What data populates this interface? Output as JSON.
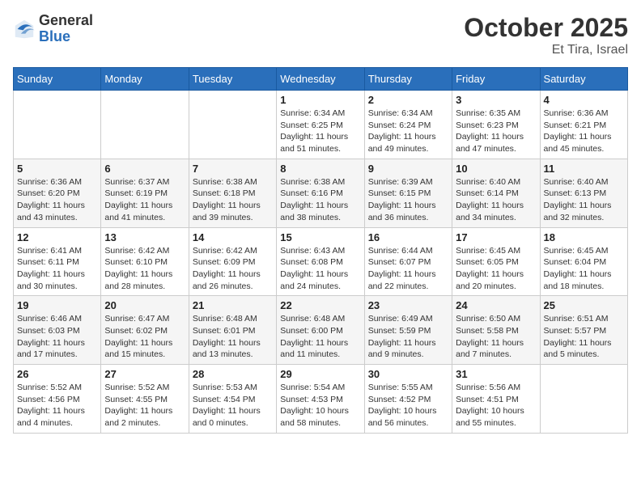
{
  "header": {
    "logo_general": "General",
    "logo_blue": "Blue",
    "month_title": "October 2025",
    "location": "Et Tira, Israel"
  },
  "days_of_week": [
    "Sunday",
    "Monday",
    "Tuesday",
    "Wednesday",
    "Thursday",
    "Friday",
    "Saturday"
  ],
  "weeks": [
    [
      {
        "day": "",
        "info": ""
      },
      {
        "day": "",
        "info": ""
      },
      {
        "day": "",
        "info": ""
      },
      {
        "day": "1",
        "info": "Sunrise: 6:34 AM\nSunset: 6:25 PM\nDaylight: 11 hours\nand 51 minutes."
      },
      {
        "day": "2",
        "info": "Sunrise: 6:34 AM\nSunset: 6:24 PM\nDaylight: 11 hours\nand 49 minutes."
      },
      {
        "day": "3",
        "info": "Sunrise: 6:35 AM\nSunset: 6:23 PM\nDaylight: 11 hours\nand 47 minutes."
      },
      {
        "day": "4",
        "info": "Sunrise: 6:36 AM\nSunset: 6:21 PM\nDaylight: 11 hours\nand 45 minutes."
      }
    ],
    [
      {
        "day": "5",
        "info": "Sunrise: 6:36 AM\nSunset: 6:20 PM\nDaylight: 11 hours\nand 43 minutes."
      },
      {
        "day": "6",
        "info": "Sunrise: 6:37 AM\nSunset: 6:19 PM\nDaylight: 11 hours\nand 41 minutes."
      },
      {
        "day": "7",
        "info": "Sunrise: 6:38 AM\nSunset: 6:18 PM\nDaylight: 11 hours\nand 39 minutes."
      },
      {
        "day": "8",
        "info": "Sunrise: 6:38 AM\nSunset: 6:16 PM\nDaylight: 11 hours\nand 38 minutes."
      },
      {
        "day": "9",
        "info": "Sunrise: 6:39 AM\nSunset: 6:15 PM\nDaylight: 11 hours\nand 36 minutes."
      },
      {
        "day": "10",
        "info": "Sunrise: 6:40 AM\nSunset: 6:14 PM\nDaylight: 11 hours\nand 34 minutes."
      },
      {
        "day": "11",
        "info": "Sunrise: 6:40 AM\nSunset: 6:13 PM\nDaylight: 11 hours\nand 32 minutes."
      }
    ],
    [
      {
        "day": "12",
        "info": "Sunrise: 6:41 AM\nSunset: 6:11 PM\nDaylight: 11 hours\nand 30 minutes."
      },
      {
        "day": "13",
        "info": "Sunrise: 6:42 AM\nSunset: 6:10 PM\nDaylight: 11 hours\nand 28 minutes."
      },
      {
        "day": "14",
        "info": "Sunrise: 6:42 AM\nSunset: 6:09 PM\nDaylight: 11 hours\nand 26 minutes."
      },
      {
        "day": "15",
        "info": "Sunrise: 6:43 AM\nSunset: 6:08 PM\nDaylight: 11 hours\nand 24 minutes."
      },
      {
        "day": "16",
        "info": "Sunrise: 6:44 AM\nSunset: 6:07 PM\nDaylight: 11 hours\nand 22 minutes."
      },
      {
        "day": "17",
        "info": "Sunrise: 6:45 AM\nSunset: 6:05 PM\nDaylight: 11 hours\nand 20 minutes."
      },
      {
        "day": "18",
        "info": "Sunrise: 6:45 AM\nSunset: 6:04 PM\nDaylight: 11 hours\nand 18 minutes."
      }
    ],
    [
      {
        "day": "19",
        "info": "Sunrise: 6:46 AM\nSunset: 6:03 PM\nDaylight: 11 hours\nand 17 minutes."
      },
      {
        "day": "20",
        "info": "Sunrise: 6:47 AM\nSunset: 6:02 PM\nDaylight: 11 hours\nand 15 minutes."
      },
      {
        "day": "21",
        "info": "Sunrise: 6:48 AM\nSunset: 6:01 PM\nDaylight: 11 hours\nand 13 minutes."
      },
      {
        "day": "22",
        "info": "Sunrise: 6:48 AM\nSunset: 6:00 PM\nDaylight: 11 hours\nand 11 minutes."
      },
      {
        "day": "23",
        "info": "Sunrise: 6:49 AM\nSunset: 5:59 PM\nDaylight: 11 hours\nand 9 minutes."
      },
      {
        "day": "24",
        "info": "Sunrise: 6:50 AM\nSunset: 5:58 PM\nDaylight: 11 hours\nand 7 minutes."
      },
      {
        "day": "25",
        "info": "Sunrise: 6:51 AM\nSunset: 5:57 PM\nDaylight: 11 hours\nand 5 minutes."
      }
    ],
    [
      {
        "day": "26",
        "info": "Sunrise: 5:52 AM\nSunset: 4:56 PM\nDaylight: 11 hours\nand 4 minutes."
      },
      {
        "day": "27",
        "info": "Sunrise: 5:52 AM\nSunset: 4:55 PM\nDaylight: 11 hours\nand 2 minutes."
      },
      {
        "day": "28",
        "info": "Sunrise: 5:53 AM\nSunset: 4:54 PM\nDaylight: 11 hours\nand 0 minutes."
      },
      {
        "day": "29",
        "info": "Sunrise: 5:54 AM\nSunset: 4:53 PM\nDaylight: 10 hours\nand 58 minutes."
      },
      {
        "day": "30",
        "info": "Sunrise: 5:55 AM\nSunset: 4:52 PM\nDaylight: 10 hours\nand 56 minutes."
      },
      {
        "day": "31",
        "info": "Sunrise: 5:56 AM\nSunset: 4:51 PM\nDaylight: 10 hours\nand 55 minutes."
      },
      {
        "day": "",
        "info": ""
      }
    ]
  ]
}
